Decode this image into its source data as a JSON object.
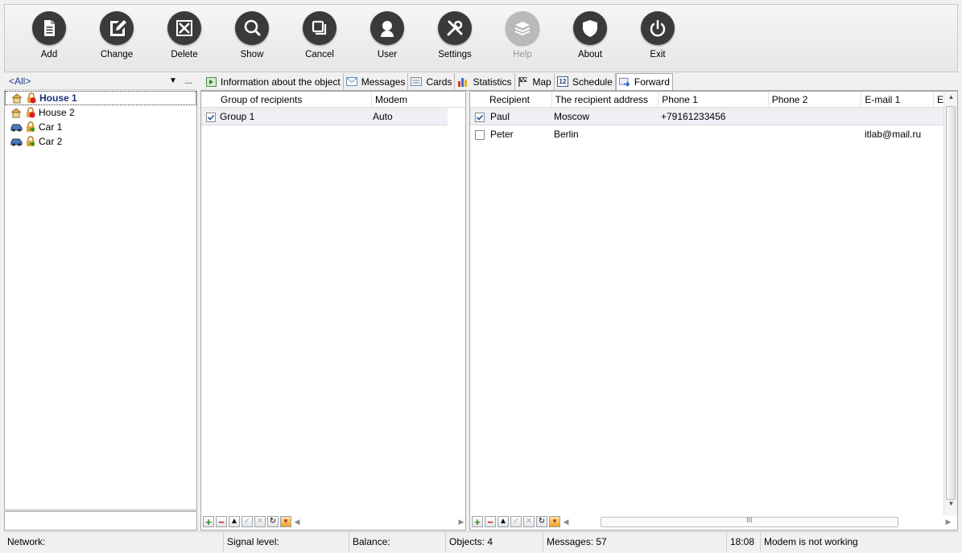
{
  "toolbar": {
    "buttons": [
      {
        "label": "Add",
        "icon": "document-icon",
        "enabled": true
      },
      {
        "label": "Change",
        "icon": "edit-icon",
        "enabled": true
      },
      {
        "label": "Delete",
        "icon": "delete-icon",
        "enabled": true
      },
      {
        "label": "Show",
        "icon": "magnifier-icon",
        "enabled": true
      },
      {
        "label": "Cancel",
        "icon": "windows-icon",
        "enabled": true
      },
      {
        "label": "User",
        "icon": "user-icon",
        "enabled": true
      },
      {
        "label": "Settings",
        "icon": "tools-icon",
        "enabled": true
      },
      {
        "label": "Help",
        "icon": "layers-icon",
        "enabled": false
      },
      {
        "label": "About",
        "icon": "shield-icon",
        "enabled": true
      },
      {
        "label": "Exit",
        "icon": "power-icon",
        "enabled": true
      }
    ]
  },
  "left": {
    "filter_value": "<All>",
    "filter_more": "...",
    "objects": [
      {
        "label": "House 1",
        "type": "house",
        "selected": true
      },
      {
        "label": "House 2",
        "type": "house",
        "selected": false
      },
      {
        "label": "Car 1",
        "type": "car",
        "selected": false
      },
      {
        "label": "Car 2",
        "type": "car",
        "selected": false
      }
    ]
  },
  "tabs": [
    {
      "label": "Information about the object",
      "icon": "play-icon",
      "active": false
    },
    {
      "label": "Messages",
      "icon": "envelope-icon",
      "active": false
    },
    {
      "label": "Cards",
      "icon": "card-icon",
      "active": false
    },
    {
      "label": "Statistics",
      "icon": "bar-chart-icon",
      "active": false
    },
    {
      "label": "Map",
      "icon": "map-flag-icon",
      "active": false
    },
    {
      "label": "Schedule",
      "icon": "calendar-icon",
      "active": false
    },
    {
      "label": "Forward",
      "icon": "forward-icon",
      "active": true
    }
  ],
  "schedule_icon_text": "12",
  "groups": {
    "columns": [
      "Group of recipients",
      "Modem"
    ],
    "rows": [
      {
        "name": "Group 1",
        "modem": "Auto",
        "checked": true
      }
    ]
  },
  "recipients": {
    "columns": [
      "Recipient",
      "The recipient address",
      "Phone 1",
      "Phone 2",
      "E-mail 1",
      "E"
    ],
    "rows": [
      {
        "name": "Paul",
        "address": "Moscow",
        "phone1": "+79161233456",
        "phone2": "",
        "email1": "",
        "checked": true
      },
      {
        "name": "Peter",
        "address": "Berlin",
        "phone1": "",
        "phone2": "",
        "email1": "itlab@mail.ru",
        "checked": false
      }
    ]
  },
  "status": {
    "network": "Network:",
    "signal": "Signal level:",
    "balance": "Balance:",
    "objects": "Objects: 4",
    "messages": "Messages: 57",
    "time": "18:08",
    "modem": "Modem is not working"
  },
  "colors": {
    "toolbar_icon": "#3a3a3a",
    "disabled_icon": "#b9b9b9",
    "tree_selected": "#1a2f7a",
    "filter_text": "#1a3e91"
  }
}
